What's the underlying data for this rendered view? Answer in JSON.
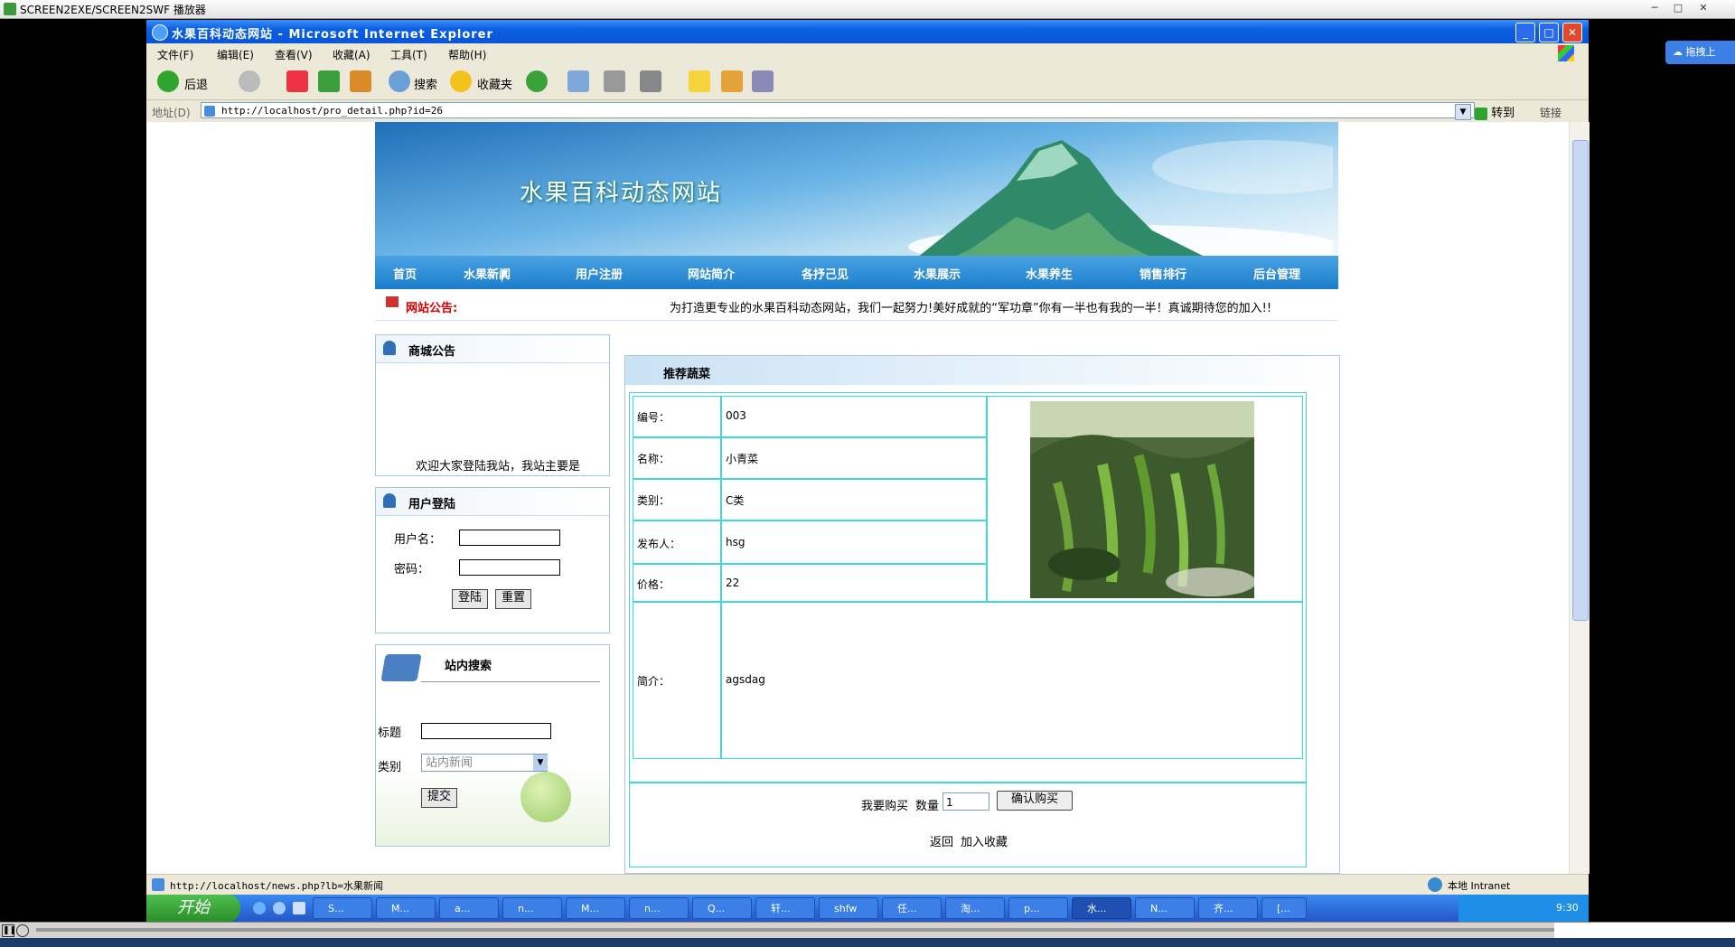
{
  "player": {
    "title": "SCREEN2EXE/SCREEN2SWF 播放器"
  },
  "cloud_badge": "拖拽上",
  "window": {
    "title": "水果百科动态网站 - Microsoft Internet Explorer"
  },
  "menu": [
    "文件(F)",
    "编辑(E)",
    "查看(V)",
    "收藏(A)",
    "工具(T)",
    "帮助(H)"
  ],
  "toolbar": {
    "back": "后退",
    "search": "搜索",
    "favorites": "收藏夹"
  },
  "address": {
    "label": "地址(D)",
    "url": "http://localhost/pro_detail.php?id=26",
    "go": "转到",
    "links": "链接"
  },
  "site": {
    "title": "水果百科动态网站",
    "nav": [
      "首页",
      "水果新闻",
      "用户注册",
      "网站简介",
      "各抒己见",
      "水果展示",
      "水果养生",
      "销售排行",
      "后台管理"
    ],
    "notice_label": "网站公告:",
    "notice_text": "为打造更专业的水果百科动态网站，我们一起努力!美好成就的“军功章”你有一半也有我的一半！真诚期待您的加入!!"
  },
  "sidebar": {
    "announce": {
      "title": "商城公告",
      "text": "欢迎大家登陆我站，我站主要是"
    },
    "login": {
      "title": "用户登陆",
      "username_label": "用户名：",
      "password_label": "密码：",
      "submit": "登陆",
      "reset": "重置"
    },
    "search": {
      "title": "站内搜索",
      "title_label": "标题",
      "category_label": "类别",
      "category_value": "站内新闻",
      "submit": "提交"
    }
  },
  "product": {
    "section_title": "推荐蔬菜",
    "rows": [
      {
        "label": "编号：",
        "value": "003"
      },
      {
        "label": "名称：",
        "value": "小青菜"
      },
      {
        "label": "类别：",
        "value": "C类"
      },
      {
        "label": "发布人：",
        "value": "hsg"
      },
      {
        "label": "价格：",
        "value": "22"
      }
    ],
    "intro_label": "简介：",
    "intro_value": "agsdag",
    "buy_label": "我要购买",
    "qty_label": "数量",
    "qty_value": "1",
    "confirm": "确认购买",
    "back": "返回",
    "favorite": "加入收藏"
  },
  "status": {
    "url": "http://localhost/news.php?lb=水果新闻",
    "zone": "本地 Intranet"
  },
  "taskbar": {
    "start": "开始",
    "items": [
      "S...",
      "M...",
      "a...",
      "n...",
      "M...",
      "n...",
      "Q...",
      "轩...",
      "shfw",
      "任...",
      "淘...",
      "p...",
      "水...",
      "N...",
      "齐...",
      "[..."
    ],
    "clock": "9:30"
  },
  "colors": {
    "ie_blue": "#0a5fe0",
    "nav_blue": "#1b7dcc",
    "notice_red": "#d00000",
    "cell_border": "#40d6d6"
  }
}
